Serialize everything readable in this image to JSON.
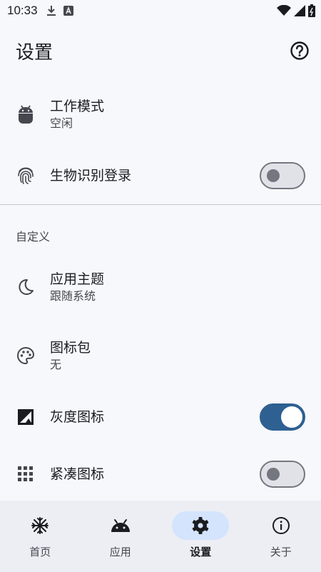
{
  "status_bar": {
    "time": "10:33",
    "icons": [
      "download-icon",
      "a-box-icon",
      "wifi-icon",
      "signal-icon",
      "battery-icon"
    ]
  },
  "app_bar": {
    "title": "设置",
    "help_icon": "help-circle-icon"
  },
  "settings": {
    "work_mode": {
      "title": "工作模式",
      "subtitle": "空闲",
      "icon": "android-icon"
    },
    "biometric": {
      "title": "生物识别登录",
      "icon": "fingerprint-icon",
      "enabled": false
    },
    "section_custom": "自定义",
    "app_theme": {
      "title": "应用主题",
      "subtitle": "跟随系统",
      "icon": "moon-icon"
    },
    "icon_pack": {
      "title": "图标包",
      "subtitle": "无",
      "icon": "palette-icon"
    },
    "grayscale_icon": {
      "title": "灰度图标",
      "icon": "grayscale-icon",
      "enabled": true
    },
    "compact_icon": {
      "title": "紧凑图标",
      "icon": "grid-icon",
      "enabled": false
    }
  },
  "bottom_nav": {
    "items": [
      {
        "label": "首页",
        "icon": "snowflake-icon"
      },
      {
        "label": "应用",
        "icon": "android-icon"
      },
      {
        "label": "设置",
        "icon": "gear-icon",
        "active": true
      },
      {
        "label": "关于",
        "icon": "info-icon"
      }
    ]
  },
  "colors": {
    "accent": "#2e6092",
    "active_pill": "#d3e4fc",
    "background": "#f7f8fc",
    "nav_background": "#eceef4"
  }
}
